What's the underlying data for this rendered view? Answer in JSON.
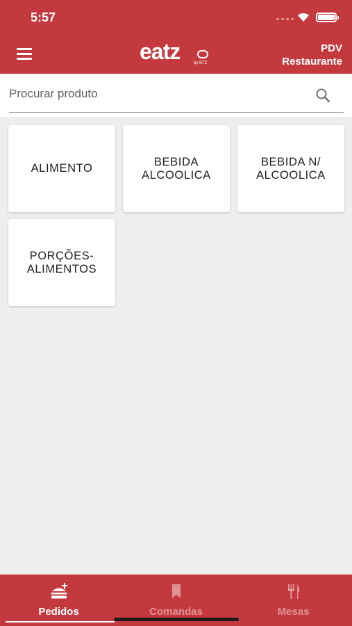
{
  "status_bar": {
    "time": "5:57"
  },
  "app_bar": {
    "menu_icon": "hamburger-icon",
    "logo_text": "eatz",
    "logo_sub": "by BTZ",
    "title_line1": "PDV",
    "title_line2": "Restaurante"
  },
  "search": {
    "placeholder": "Procurar produto",
    "value": "",
    "icon": "search-icon"
  },
  "categories": [
    {
      "label": "ALIMENTO"
    },
    {
      "label": "BEBIDA ALCOOLICA"
    },
    {
      "label": "BEBIDA N/ ALCOOLICA"
    },
    {
      "label": "PORÇÕES-ALIMENTOS"
    }
  ],
  "tabs": [
    {
      "label": "Pedidos",
      "icon": "food-icon",
      "active": true
    },
    {
      "label": "Comandas",
      "icon": "bookmark-icon",
      "active": false
    },
    {
      "label": "Mesas",
      "icon": "cutlery-icon",
      "active": false
    }
  ],
  "colors": {
    "primary": "#c4393e",
    "background": "#eeeeee"
  }
}
